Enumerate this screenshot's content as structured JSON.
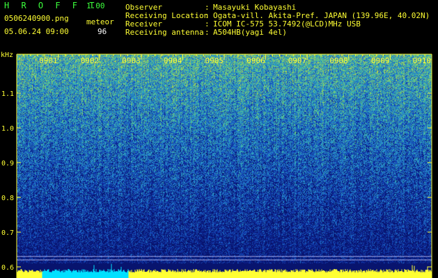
{
  "header": {
    "app_title": "H R O F F T",
    "version": "1.00",
    "filename": "0506240900.png",
    "mode": "meteor",
    "datetime": "05.06.24 09:00",
    "count": "96"
  },
  "info": [
    {
      "key": "Observer",
      "value": "Masayuki Kobayashi"
    },
    {
      "key": "Receiving Location",
      "value": "Ogata-vill. Akita-Pref. JAPAN (139.96E, 40.02N)"
    },
    {
      "key": "Receiver",
      "value": "ICOM IC-575 53.7492(@LCD)MHz USB"
    },
    {
      "key": "Receiving antenna",
      "value": "A504HB(yagi 4el)"
    }
  ],
  "colors": {
    "label": "#ffff33",
    "header_green": "#3cff3c",
    "background": "#000000",
    "spectrum_low": "#0d2a8a",
    "spectrum_high": "#b8e04a",
    "baseline": "#ffff33",
    "baseline_cyan": "#00e0ff"
  },
  "chart_data": {
    "type": "heatmap",
    "x_unit": "minute",
    "x_ticks": [
      "0901",
      "0902",
      "0903",
      "0904",
      "0905",
      "0906",
      "0907",
      "0908",
      "0909",
      "0910"
    ],
    "y_unit": "kHz",
    "y_ticks": [
      "0.6",
      "0.7",
      "0.8",
      "0.9",
      "1.0",
      "1.1"
    ],
    "ylim": [
      0.58,
      1.2
    ],
    "xlim": [
      "0900",
      "0910"
    ]
  }
}
